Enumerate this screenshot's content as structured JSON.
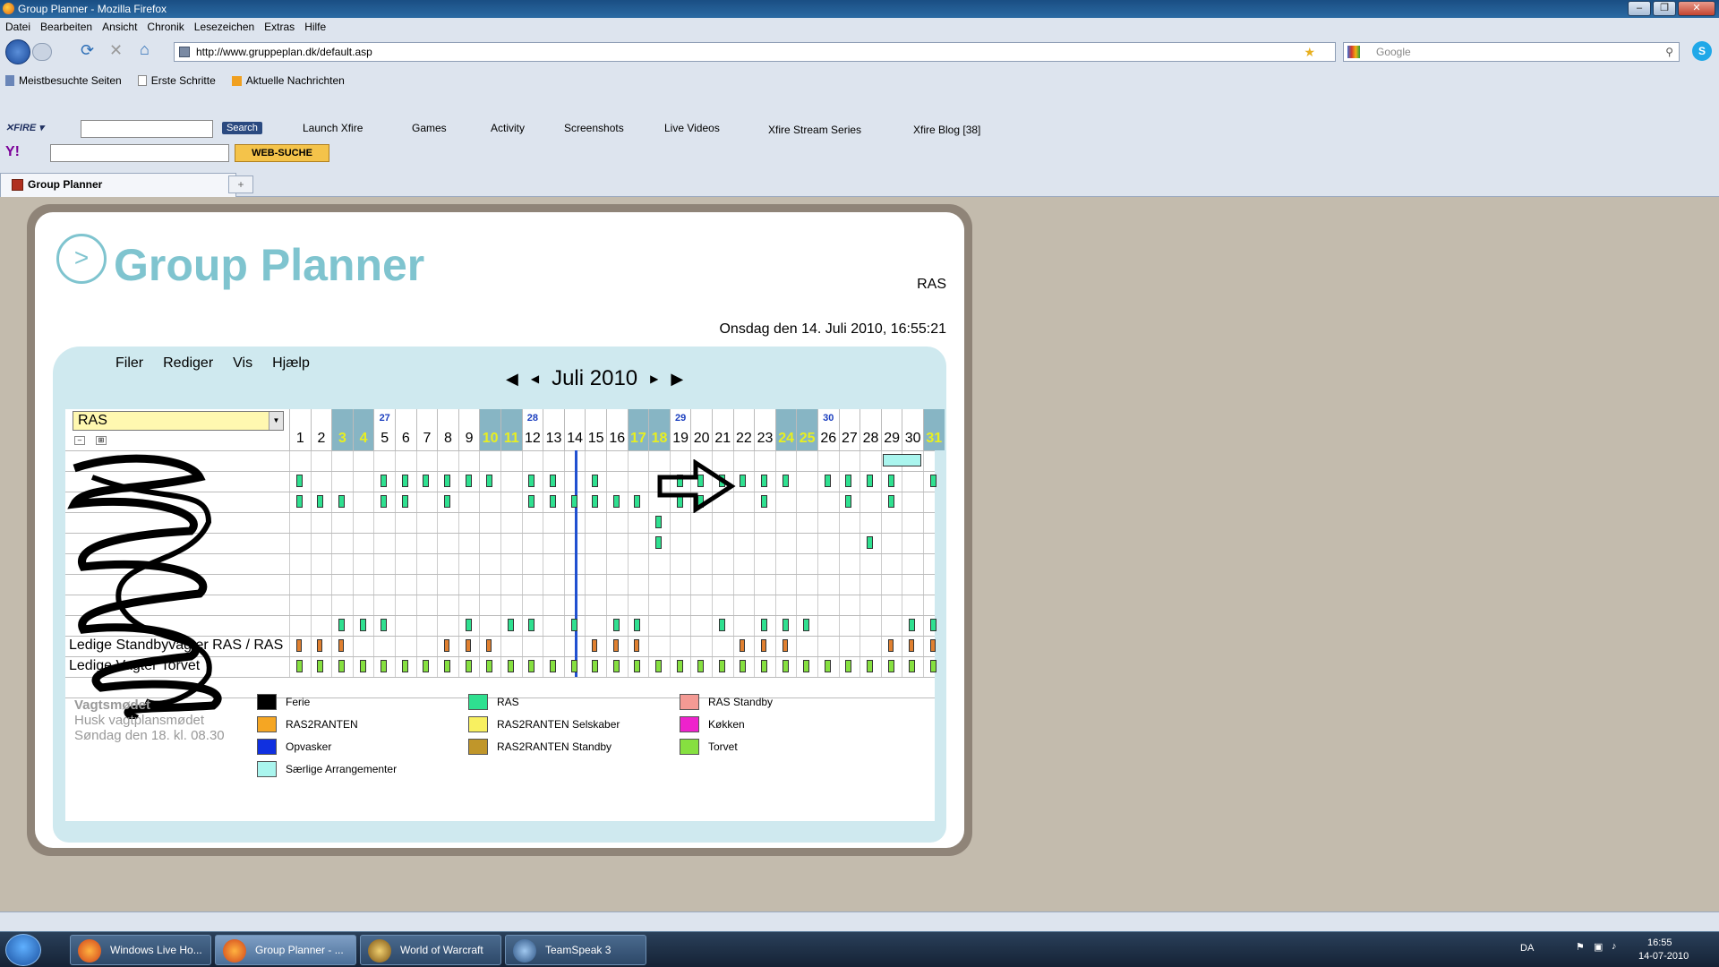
{
  "window": {
    "title": "Group Planner - Mozilla Firefox"
  },
  "menubar": [
    "Datei",
    "Bearbeiten",
    "Ansicht",
    "Chronik",
    "Lesezeichen",
    "Extras",
    "Hilfe"
  ],
  "urlbar": {
    "url": "http://www.gruppeplan.dk/default.asp"
  },
  "searchbar": {
    "placeholder": "Google"
  },
  "bookmarks": [
    "Meistbesuchte Seiten",
    "Erste Schritte",
    "Aktuelle Nachrichten"
  ],
  "xfire": {
    "search_btn": "Search",
    "items": [
      "Launch Xfire",
      "Games",
      "Activity",
      "Screenshots",
      "Live Videos",
      "Xfire Stream Series",
      "Xfire Blog [38]"
    ]
  },
  "yahoo": {
    "websuche": "WEB-SUCHE"
  },
  "tab": {
    "label": "Group Planner"
  },
  "app": {
    "logo": "Group Planner",
    "logo_symbol": ">",
    "user": "RAS",
    "datetime": "Onsdag den 14. Juli 2010, 16:55:21",
    "menu": [
      "Filer",
      "Rediger",
      "Vis",
      "Hjælp"
    ],
    "month": "Juli 2010",
    "select_value": "RAS",
    "days": [
      {
        "d": "1",
        "we": false,
        "wk": ""
      },
      {
        "d": "2",
        "we": false,
        "wk": ""
      },
      {
        "d": "3",
        "we": true,
        "wk": ""
      },
      {
        "d": "4",
        "we": true,
        "wk": ""
      },
      {
        "d": "5",
        "we": false,
        "wk": "27"
      },
      {
        "d": "6",
        "we": false,
        "wk": ""
      },
      {
        "d": "7",
        "we": false,
        "wk": ""
      },
      {
        "d": "8",
        "we": false,
        "wk": ""
      },
      {
        "d": "9",
        "we": false,
        "wk": ""
      },
      {
        "d": "10",
        "we": true,
        "wk": ""
      },
      {
        "d": "11",
        "we": true,
        "wk": ""
      },
      {
        "d": "12",
        "we": false,
        "wk": "28"
      },
      {
        "d": "13",
        "we": false,
        "wk": ""
      },
      {
        "d": "14",
        "we": false,
        "wk": ""
      },
      {
        "d": "15",
        "we": false,
        "wk": ""
      },
      {
        "d": "16",
        "we": false,
        "wk": ""
      },
      {
        "d": "17",
        "we": true,
        "wk": ""
      },
      {
        "d": "18",
        "we": true,
        "wk": ""
      },
      {
        "d": "19",
        "we": false,
        "wk": "29"
      },
      {
        "d": "20",
        "we": false,
        "wk": ""
      },
      {
        "d": "21",
        "we": false,
        "wk": ""
      },
      {
        "d": "22",
        "we": false,
        "wk": ""
      },
      {
        "d": "23",
        "we": false,
        "wk": ""
      },
      {
        "d": "24",
        "we": true,
        "wk": ""
      },
      {
        "d": "25",
        "we": true,
        "wk": ""
      },
      {
        "d": "26",
        "we": false,
        "wk": "30"
      },
      {
        "d": "27",
        "we": false,
        "wk": ""
      },
      {
        "d": "28",
        "we": false,
        "wk": ""
      },
      {
        "d": "29",
        "we": false,
        "wk": ""
      },
      {
        "d": "30",
        "we": false,
        "wk": ""
      },
      {
        "d": "31",
        "we": true,
        "wk": ""
      }
    ],
    "row_labels": [
      "Ledige Standbyvagter RAS / RAS",
      "Ledige Vagter Torvet"
    ],
    "note": {
      "title": "Vagtsmødet",
      "text": "Husk vagtplansmødet Søndag den 18. kl. 08.30"
    },
    "legend": [
      {
        "label": "Ferie",
        "color": "#000000"
      },
      {
        "label": "RAS",
        "color": "#2fe090"
      },
      {
        "label": "RAS Standby",
        "color": "#f49a94"
      },
      {
        "label": "RAS2RANTEN",
        "color": "#f5a623"
      },
      {
        "label": "RAS2RANTEN Selskaber",
        "color": "#f8f060"
      },
      {
        "label": "Køkken",
        "color": "#ee22cc"
      },
      {
        "label": "Opvasker",
        "color": "#1030e0"
      },
      {
        "label": "RAS2RANTEN Standby",
        "color": "#c0962a"
      },
      {
        "label": "Torvet",
        "color": "#86e040"
      },
      {
        "label": "Særlige Arrangementer",
        "color": "#aaf5ee"
      }
    ],
    "highlight_colors": {
      "weekend": "#87b5c4",
      "today_line": "#2050d0"
    }
  },
  "taskbar": {
    "items": [
      "Windows Live Ho...",
      "Group Planner - ...",
      "World of Warcraft",
      "TeamSpeak 3"
    ],
    "lang": "DA",
    "time": "16:55",
    "date": "14-07-2010"
  }
}
